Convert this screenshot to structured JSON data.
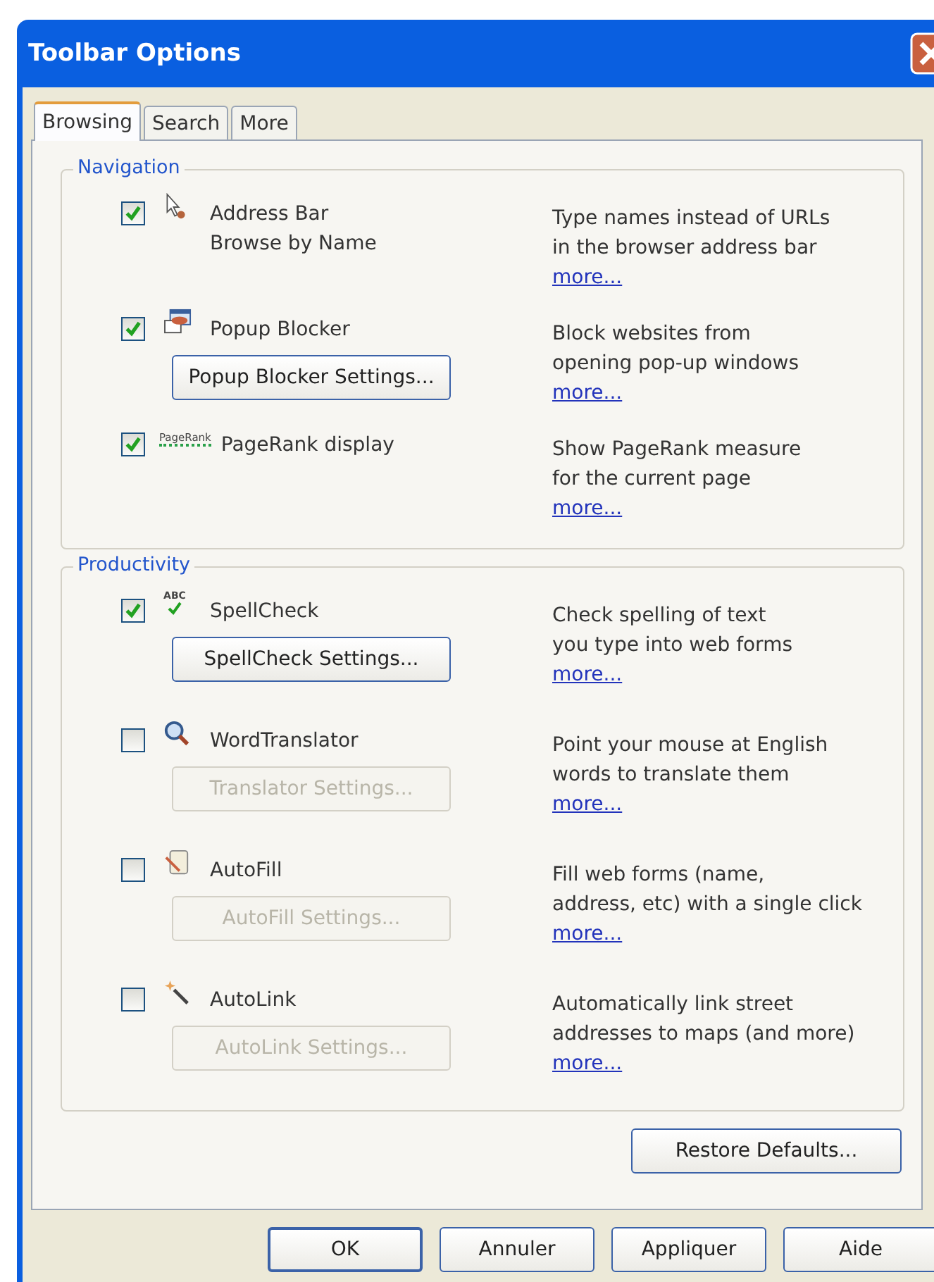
{
  "window": {
    "title": "Toolbar Options"
  },
  "tabs": [
    {
      "label": "Browsing",
      "selected": true
    },
    {
      "label": "Search",
      "selected": false
    },
    {
      "label": "More",
      "selected": false
    }
  ],
  "groups": [
    {
      "title": "Navigation",
      "items": [
        {
          "label_lines": [
            "Address Bar",
            "Browse by Name"
          ],
          "checked": true,
          "description_lines": [
            "Type names instead of URLs",
            "in the browser address bar"
          ],
          "link": "more..."
        },
        {
          "label_lines": [
            "Popup Blocker"
          ],
          "checked": true,
          "button": {
            "label": "Popup Blocker Settings...",
            "disabled": false
          },
          "description_lines": [
            "Block websites from",
            "opening pop-up windows"
          ],
          "link": "more..."
        },
        {
          "label_lines": [
            "PageRank display"
          ],
          "checked": true,
          "badge": "PageRank",
          "description_lines": [
            "Show PageRank measure",
            "for the current page"
          ],
          "link": "more..."
        }
      ]
    },
    {
      "title": "Productivity",
      "items": [
        {
          "label_lines": [
            "SpellCheck"
          ],
          "checked": true,
          "badge": "ABC",
          "button": {
            "label": "SpellCheck Settings...",
            "disabled": false
          },
          "description_lines": [
            "Check spelling of text",
            "you type into web forms"
          ],
          "link": "more..."
        },
        {
          "label_lines": [
            "WordTranslator"
          ],
          "checked": false,
          "button": {
            "label": "Translator Settings...",
            "disabled": true
          },
          "description_lines": [
            "Point your mouse at English",
            "words to translate them"
          ],
          "link": "more..."
        },
        {
          "label_lines": [
            "AutoFill"
          ],
          "checked": false,
          "button": {
            "label": "AutoFill Settings...",
            "disabled": true
          },
          "description_lines": [
            "Fill web forms (name,",
            "address, etc) with a single click"
          ],
          "link": "more..."
        },
        {
          "label_lines": [
            "AutoLink"
          ],
          "checked": false,
          "button": {
            "label": "AutoLink Settings...",
            "disabled": true
          },
          "description_lines": [
            "Automatically link street",
            "addresses to maps (and more)"
          ],
          "link": "more..."
        }
      ]
    }
  ],
  "restore_button": "Restore Defaults...",
  "dialog_buttons": [
    "OK",
    "Annuler",
    "Appliquer",
    "Aide"
  ]
}
